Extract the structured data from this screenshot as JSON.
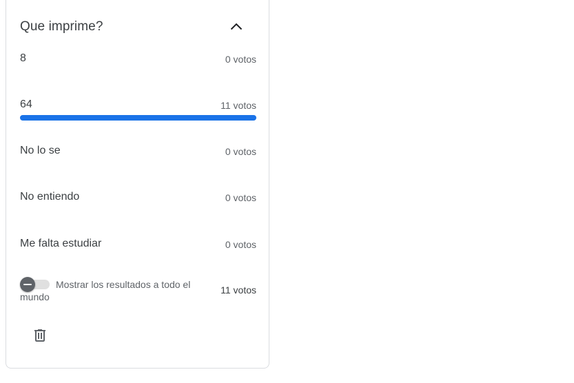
{
  "poll": {
    "question": "Que imprime?",
    "options": [
      {
        "label": "8",
        "votes": "0 votos",
        "fraction": 0
      },
      {
        "label": "64",
        "votes": "11 votos",
        "fraction": 1
      },
      {
        "label": "No lo se",
        "votes": "0 votos",
        "fraction": 0
      },
      {
        "label": "No entiendo",
        "votes": "0 votos",
        "fraction": 0
      },
      {
        "label": "Me falta estudiar",
        "votes": "0 votos",
        "fraction": 0
      }
    ],
    "show_results_label": "Mostrar los resultados a todo el mundo",
    "show_results_enabled": false,
    "total_votes": "11 votos"
  },
  "icons": {
    "collapse": "chevron-up-icon",
    "delete": "trash-icon"
  },
  "colors": {
    "accent": "#1a73e8",
    "text": "#3c4043",
    "secondary_text": "#5f6368"
  }
}
